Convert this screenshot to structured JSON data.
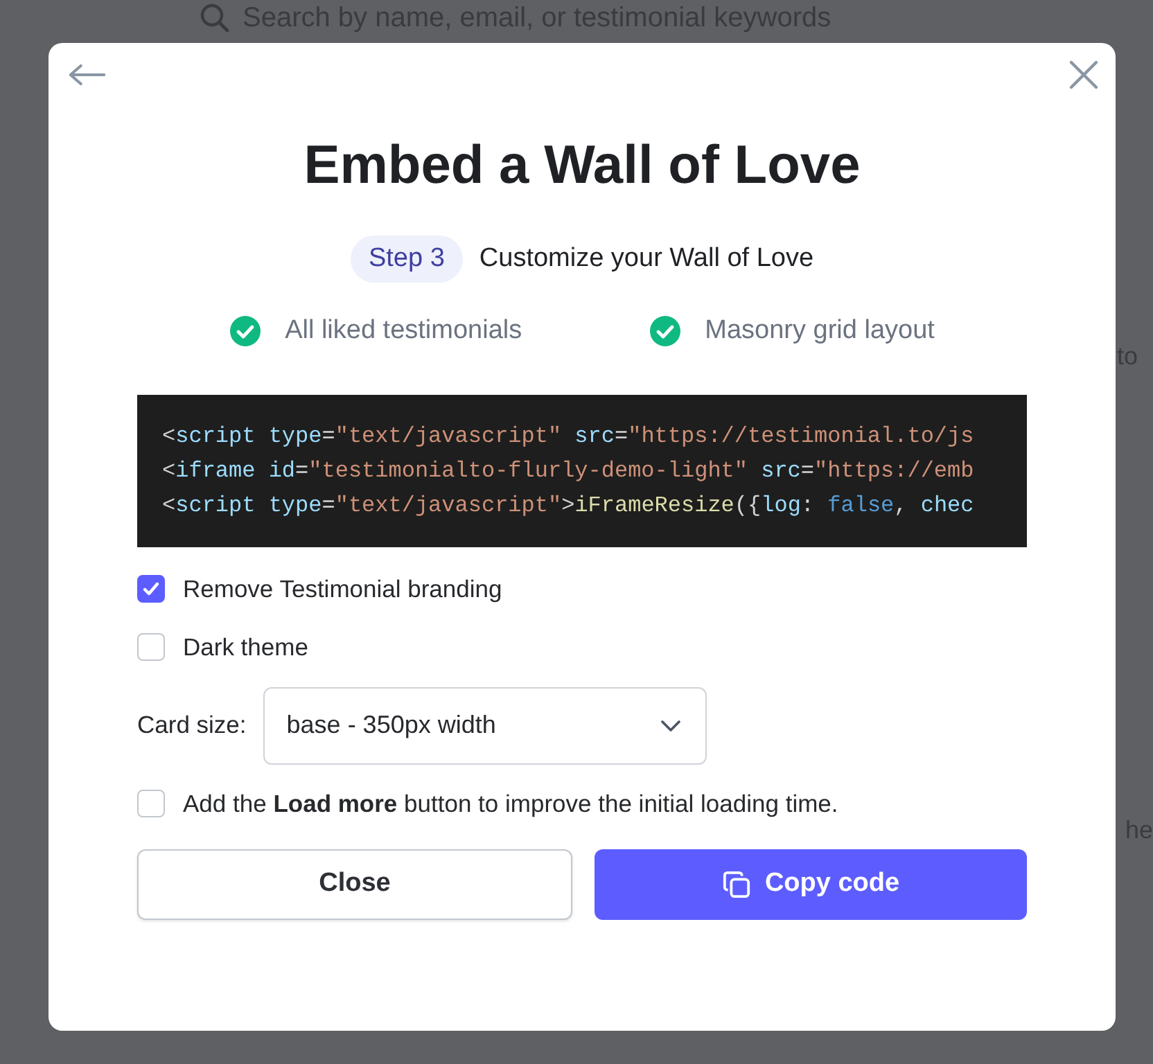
{
  "backdrop": {
    "search_placeholder": "Search by name, email, or testimonial keywords",
    "fragments": [
      "to",
      "he"
    ]
  },
  "modal": {
    "title": "Embed a Wall of Love",
    "step_badge": "Step 3",
    "step_title": "Customize your Wall of Love",
    "features": [
      {
        "label": "All liked testimonials",
        "checked": true
      },
      {
        "label": "Masonry grid layout",
        "checked": true
      }
    ],
    "code_lines": [
      [
        {
          "kind": "punct",
          "text": "<"
        },
        {
          "kind": "tag",
          "text": "script"
        },
        {
          "kind": "attr",
          "text": " type"
        },
        {
          "kind": "punct",
          "text": "="
        },
        {
          "kind": "string",
          "text": "\"text/javascript\""
        },
        {
          "kind": "attr",
          "text": " src"
        },
        {
          "kind": "punct",
          "text": "="
        },
        {
          "kind": "string",
          "text": "\"https://testimonial.to/js"
        }
      ],
      [
        {
          "kind": "punct",
          "text": "<"
        },
        {
          "kind": "tag",
          "text": "iframe"
        },
        {
          "kind": "attr",
          "text": " id"
        },
        {
          "kind": "punct",
          "text": "="
        },
        {
          "kind": "string",
          "text": "\"testimonialto-flurly-demo-light\""
        },
        {
          "kind": "attr",
          "text": " src"
        },
        {
          "kind": "punct",
          "text": "="
        },
        {
          "kind": "string",
          "text": "\"https://emb"
        }
      ],
      [
        {
          "kind": "punct",
          "text": "<"
        },
        {
          "kind": "tag",
          "text": "script"
        },
        {
          "kind": "attr",
          "text": " type"
        },
        {
          "kind": "punct",
          "text": "="
        },
        {
          "kind": "string",
          "text": "\"text/javascript\""
        },
        {
          "kind": "punct",
          "text": ">"
        },
        {
          "kind": "func",
          "text": "iFrameResize"
        },
        {
          "kind": "punct",
          "text": "({"
        },
        {
          "kind": "attr",
          "text": "log"
        },
        {
          "kind": "punct",
          "text": ":"
        },
        {
          "kind": "keyword",
          "text": " false"
        },
        {
          "kind": "punct",
          "text": ","
        },
        {
          "kind": "attr",
          "text": " chec"
        }
      ]
    ],
    "options": [
      {
        "label": "Remove Testimonial branding",
        "checked": true
      },
      {
        "label": "Dark theme",
        "checked": false
      }
    ],
    "card_size": {
      "label": "Card size:",
      "value": "base - 350px width"
    },
    "load_more": {
      "label": "Add the **Load more** button to improve the initial loading time.",
      "checked": false
    },
    "buttons": {
      "close": "Close",
      "copy": "Copy code"
    }
  }
}
